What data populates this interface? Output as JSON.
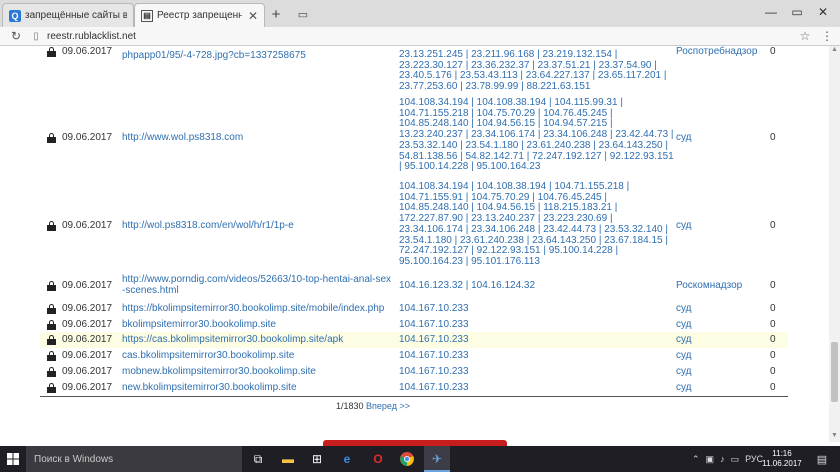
{
  "browser": {
    "tabs": [
      {
        "title": "запрещённые сайты в россии",
        "active": false
      },
      {
        "title": "Реестр запрещенных сайтов",
        "active": true
      }
    ],
    "url": "reestr.rublacklist.net"
  },
  "rows": [
    {
      "date": "09.06.2017",
      "url": "phpapp01/95/-4-728.jpg?cb=1337258675",
      "ips": "23.13.251.245 | 23.211.96.168 | 23.219.132.154 | 23.223.30.127 | 23.36.232.37 | 23.37.51.21 | 23.37.54.90 | 23.40.5.176 | 23.53.43.113 | 23.64.227.137 | 23.65.117.201 | 23.77.253.60 | 23.78.99.99 | 88.221.63.151",
      "org": "Роспотребнадзор",
      "count": "0"
    },
    {
      "date": "09.06.2017",
      "url": "http://www.wol.ps8318.com",
      "ips": "104.108.34.194 | 104.108.38.194 | 104.115.99.31 | 104.71.155.218 | 104.75.70.29 | 104.76.45.245 | 104.85.248.140 | 104.94.56.15 | 104.94.57.215 | 13.23.240.237 | 23.34.106.174 | 23.34.106.248 | 23.42.44.73 | 23.53.32.140 | 23.54.1.180 | 23.61.240.238 | 23.64.143.250 | 54.81.138.56 | 54.82.142.71 | 72.247.192.127 | 92.122.93.151 | 95.100.14.228 | 95.100.164.23",
      "org": "суд",
      "count": "0"
    },
    {
      "date": "09.06.2017",
      "url": "http://wol.ps8318.com/en/wol/h/r1/1p-e",
      "ips": "104.108.34.194 | 104.108.38.194 | 104.71.155.218 | 104.71.155.91 | 104.75.70.29 | 104.76.45.245 | 104.85.248.140 | 104.94.56.15 | 118.215.183.21 | 172.227.87.90 | 23.13.240.237 | 23.223.230.69 | 23.34.106.174 | 23.34.106.248 | 23.42.44.73 | 23.53.32.140 | 23.54.1.180 | 23.61.240.238 | 23.64.143.250 | 23.67.184.15 | 72.247.192.127 | 92.122.93.151 | 95.100.14.228 | 95.100.164.23 | 95.101.176.113",
      "org": "суд",
      "count": "0"
    },
    {
      "date": "09.06.2017",
      "url": "http://www.porndig.com/videos/52663/10-top-hentai-anal-sex-scenes.html",
      "ips": "104.16.123.32 | 104.16.124.32",
      "org": "Роскомнадзор",
      "count": "0"
    },
    {
      "date": "09.06.2017",
      "url": "https://bkolimpsitemirror30.bookolimp.site/mobile/index.php",
      "ips": "104.167.10.233",
      "org": "суд",
      "count": "0"
    },
    {
      "date": "09.06.2017",
      "url": "bkolimpsitemirror30.bookolimp.site",
      "ips": "104.167.10.233",
      "org": "суд",
      "count": "0"
    },
    {
      "date": "09.06.2017",
      "url": "https://cas.bkolimpsitemirror30.bookolimp.site/apk",
      "ips": "104.167.10.233",
      "org": "суд",
      "count": "0"
    },
    {
      "date": "09.06.2017",
      "url": "cas.bkolimpsitemirror30.bookolimp.site",
      "ips": "104.167.10.233",
      "org": "суд",
      "count": "0"
    },
    {
      "date": "09.06.2017",
      "url": "mobnew.bkolimpsitemirror30.bookolimp.site",
      "ips": "104.167.10.233",
      "org": "суд",
      "count": "0"
    },
    {
      "date": "09.06.2017",
      "url": "new.bkolimpsitemirror30.bookolimp.site",
      "ips": "104.167.10.233",
      "org": "суд",
      "count": "0"
    }
  ],
  "pagination": {
    "current": "1/1830",
    "next_label": "Вперед >>"
  },
  "taskbar": {
    "search_placeholder": "Поиск в Windows",
    "language": "РУС",
    "time": "11:16",
    "date": "11.06.2017"
  },
  "colors": {
    "link": "#2f6fb0",
    "highlight_row": "#fdfde3",
    "taskbar": "#1e1e24"
  }
}
